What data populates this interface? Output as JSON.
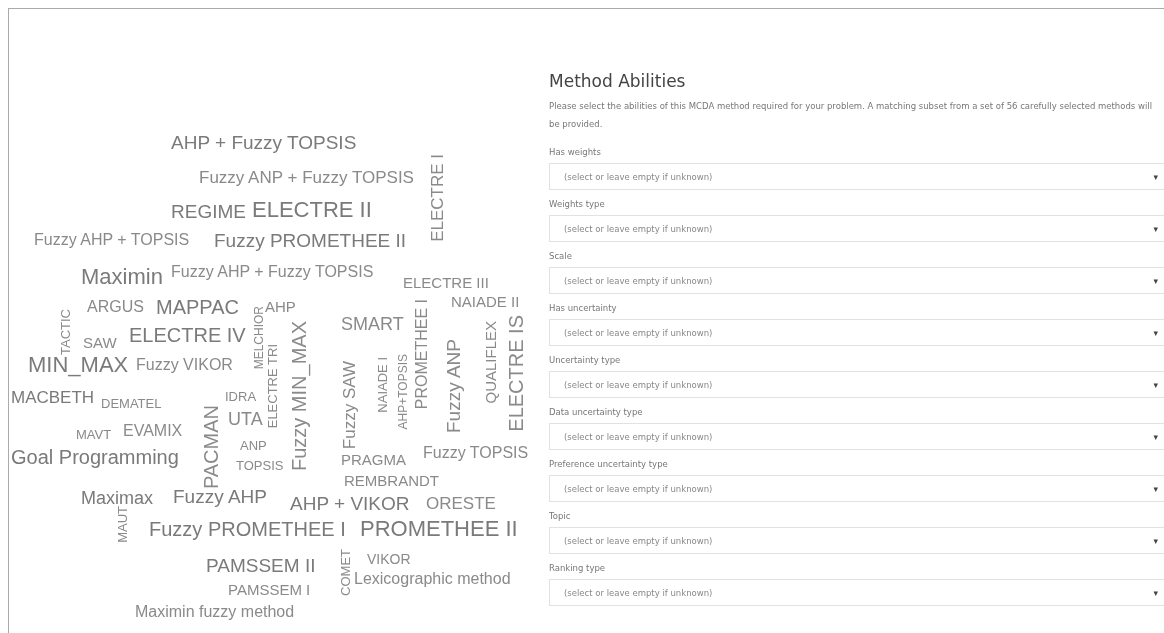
{
  "cloud": {
    "words": [
      {
        "text": "AHP + Fuzzy TOPSIS",
        "kind": "horizontal"
      },
      {
        "text": "Fuzzy ANP + Fuzzy TOPSIS",
        "kind": "horizontal"
      },
      {
        "text": "REGIME",
        "kind": "horizontal"
      },
      {
        "text": "ELECTRE II",
        "kind": "horizontal"
      },
      {
        "text": "Fuzzy AHP + TOPSIS",
        "kind": "horizontal"
      },
      {
        "text": "Fuzzy PROMETHEE II",
        "kind": "horizontal"
      },
      {
        "text": "ELECTRE I",
        "kind": "vertical"
      },
      {
        "text": "Maximin",
        "kind": "horizontal"
      },
      {
        "text": "Fuzzy AHP + Fuzzy TOPSIS",
        "kind": "horizontal"
      },
      {
        "text": "ELECTRE III",
        "kind": "horizontal"
      },
      {
        "text": "TACTIC",
        "kind": "vertical"
      },
      {
        "text": "ARGUS",
        "kind": "horizontal"
      },
      {
        "text": "MAPPAC",
        "kind": "horizontal"
      },
      {
        "text": "MELCHIOR",
        "kind": "vertical"
      },
      {
        "text": "AHP",
        "kind": "horizontal"
      },
      {
        "text": "NAIADE II",
        "kind": "horizontal"
      },
      {
        "text": "SAW",
        "kind": "horizontal"
      },
      {
        "text": "ELECTRE IV",
        "kind": "horizontal"
      },
      {
        "text": "SMART",
        "kind": "horizontal"
      },
      {
        "text": "PROMETHEE I",
        "kind": "vertical"
      },
      {
        "text": "Fuzzy ANP",
        "kind": "vertical"
      },
      {
        "text": "QUALIFLEX",
        "kind": "vertical"
      },
      {
        "text": "ELECTRE IS",
        "kind": "vertical"
      },
      {
        "text": "MIN_MAX",
        "kind": "horizontal"
      },
      {
        "text": "Fuzzy VIKOR",
        "kind": "horizontal"
      },
      {
        "text": "ELECTRE TRI",
        "kind": "vertical"
      },
      {
        "text": "Fuzzy MIN_MAX",
        "kind": "vertical"
      },
      {
        "text": "Fuzzy SAW",
        "kind": "vertical"
      },
      {
        "text": "NAIADE I",
        "kind": "vertical"
      },
      {
        "text": "AHP+TOPSIS",
        "kind": "vertical"
      },
      {
        "text": "MACBETH",
        "kind": "horizontal"
      },
      {
        "text": "DEMATEL",
        "kind": "horizontal"
      },
      {
        "text": "MAVT",
        "kind": "horizontal"
      },
      {
        "text": "EVAMIX",
        "kind": "horizontal"
      },
      {
        "text": "Goal Programming",
        "kind": "horizontal"
      },
      {
        "text": "PACMAN",
        "kind": "vertical"
      },
      {
        "text": "IDRA",
        "kind": "horizontal"
      },
      {
        "text": "UTA",
        "kind": "horizontal"
      },
      {
        "text": "ANP",
        "kind": "horizontal"
      },
      {
        "text": "TOPSIS",
        "kind": "horizontal"
      },
      {
        "text": "PRAGMA",
        "kind": "horizontal"
      },
      {
        "text": "Fuzzy TOPSIS",
        "kind": "horizontal"
      },
      {
        "text": "REMBRANDT",
        "kind": "horizontal"
      },
      {
        "text": "Maximax",
        "kind": "horizontal"
      },
      {
        "text": "Fuzzy AHP",
        "kind": "horizontal"
      },
      {
        "text": "AHP + VIKOR",
        "kind": "horizontal"
      },
      {
        "text": "ORESTE",
        "kind": "horizontal"
      },
      {
        "text": "MAUT",
        "kind": "vertical"
      },
      {
        "text": "Fuzzy PROMETHEE I",
        "kind": "horizontal"
      },
      {
        "text": "PROMETHEE II",
        "kind": "horizontal"
      },
      {
        "text": "PAMSSEM II",
        "kind": "horizontal"
      },
      {
        "text": "COMET",
        "kind": "vertical"
      },
      {
        "text": "VIKOR",
        "kind": "horizontal"
      },
      {
        "text": "Lexicographic method",
        "kind": "horizontal"
      },
      {
        "text": "PAMSSEM I",
        "kind": "horizontal"
      },
      {
        "text": "Maximin fuzzy method",
        "kind": "horizontal"
      }
    ]
  },
  "form": {
    "title": "Method Abilities",
    "description": "Please select the abilities of this MCDA method required for your problem. A matching subset from a set of 56 carefully selected methods will be provided.",
    "fields": [
      {
        "label": "Has weights",
        "placeholder": "(select or leave empty if unknown)",
        "arrow": "▾"
      },
      {
        "label": "Weights type",
        "placeholder": "(select or leave empty if unknown)",
        "arrow": "▾"
      },
      {
        "label": "Scale",
        "placeholder": "(select or leave empty if unknown)",
        "arrow": "▾"
      },
      {
        "label": "Has uncertainty",
        "placeholder": "(select or leave empty if unknown)",
        "arrow": "▾"
      },
      {
        "label": "Uncertainty type",
        "placeholder": "(select or leave empty if unknown)",
        "arrow": "▾"
      },
      {
        "label": "Data uncertainty type",
        "placeholder": "(select or leave empty if unknown)",
        "arrow": "▾"
      },
      {
        "label": "Preference uncertainty type",
        "placeholder": "(select or leave empty if unknown)",
        "arrow": "▾"
      },
      {
        "label": "Topic",
        "placeholder": "(select or leave empty if unknown)",
        "arrow": "▾"
      },
      {
        "label": "Ranking type",
        "placeholder": "(select or leave empty if unknown)",
        "arrow": "▾"
      }
    ]
  }
}
